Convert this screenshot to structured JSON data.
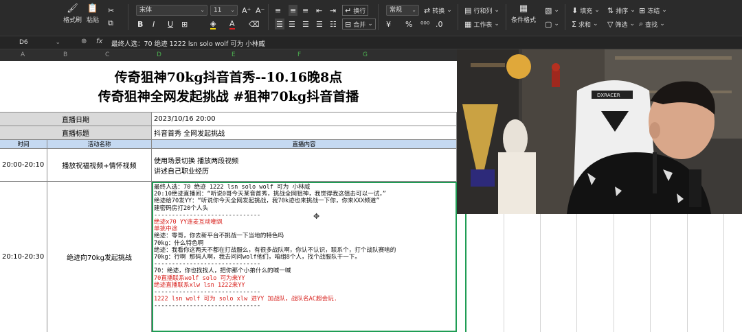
{
  "ribbon": {
    "format_painter": "格式刷",
    "paste": "粘贴",
    "font_name": "宋体",
    "font_size": "11",
    "wrap": "换行",
    "merge": "合并",
    "number_format": "常规",
    "convert": "转换",
    "row_col": "行和列",
    "worksheet": "工作表",
    "cond_format": "条件格式",
    "fill": "填充",
    "sort": "排序",
    "freeze": "冻结",
    "sum": "求和",
    "filter": "筛选",
    "find": "查找",
    "currency_symbol": "¥",
    "percent_symbol": "%"
  },
  "formula_bar": {
    "cell_ref": "D6",
    "fx": "fx",
    "content": "最终人选：70 绝迹 1222 lsn solo wolf 可为 小林威"
  },
  "columns": [
    "A",
    "B",
    "C",
    "D",
    "E",
    "F",
    "G"
  ],
  "sheet": {
    "title_line1": "传奇狙神70kg抖音首秀--10.16晚8点",
    "title_line2": "传奇狙神全网发起挑战 #狙神70kg抖音首播",
    "date_label": "直播日期",
    "date_value": "2023/10/16 20:00",
    "live_title_label": "直播标题",
    "live_title_value": "抖音首秀 全网发起挑战",
    "hdr_time": "时间",
    "hdr_activity": "活动名称",
    "hdr_content": "直播内容",
    "row1_time": "20:00-20:10",
    "row1_activity": "播放祝福视频+情怀视频",
    "row1_content_1": "使用场景切换 播放两段视频",
    "row1_content_2": "讲述自己职业经历",
    "row2_time": "20:10-20:30",
    "row2_activity": "绝迹向70kg发起挑战",
    "row2_lines": [
      {
        "t": "最终人选：70 绝迹 1222 lsn solo wolf 可为 小林威",
        "red": false
      },
      {
        "t": "20:10绝迹直播间：“听说0哥今天某音首秀，挑战全网狙神，我觉得我这狙击可以一试，”",
        "red": false
      },
      {
        "t": "绝迹给70发YY：“听说你今天全网发起挑战，我70k迹也来挑战一下你，你来XXX频道”",
        "red": false
      },
      {
        "t": "建密码房打20个人头",
        "red": false
      },
      {
        "t": "------------------------------",
        "red": false
      },
      {
        "t": "绝迹x70 YY连麦互动嘲讽",
        "red": true
      },
      {
        "t": "单挑中途",
        "red": true
      },
      {
        "t": "绝迹：零哥，你去新平台不挑战一下当地的特色吗",
        "red": false
      },
      {
        "t": "70kg：什么特色啊",
        "red": false
      },
      {
        "t": "绝迹：我看你这两天不都在打战服么，有很多战队啊，你认不认识，联系个，打个战队赛啥的",
        "red": false
      },
      {
        "t": "70kg：行啊 那码人啊，我去问问wolf他们，咱组8个人，找个战服队干一下。",
        "red": false
      },
      {
        "t": "------------------------------",
        "red": false
      },
      {
        "t": "70：绝迹，你也找找人，把你那个小弟什么的喊一喊",
        "red": false
      },
      {
        "t": "70直播联系wolf solo 可为来YY",
        "red": true
      },
      {
        "t": "绝迹直播联系xlw lsn 1222来YY",
        "red": true
      },
      {
        "t": "------------------------------",
        "red": false
      },
      {
        "t": "1222 lsn wolf 可为 solo xlw 进YY 加战队，战队名AC超会玩.",
        "red": true
      },
      {
        "t": "------------------------------",
        "red": false
      }
    ]
  },
  "webcam": {
    "chair_brand": "DXRACER"
  }
}
